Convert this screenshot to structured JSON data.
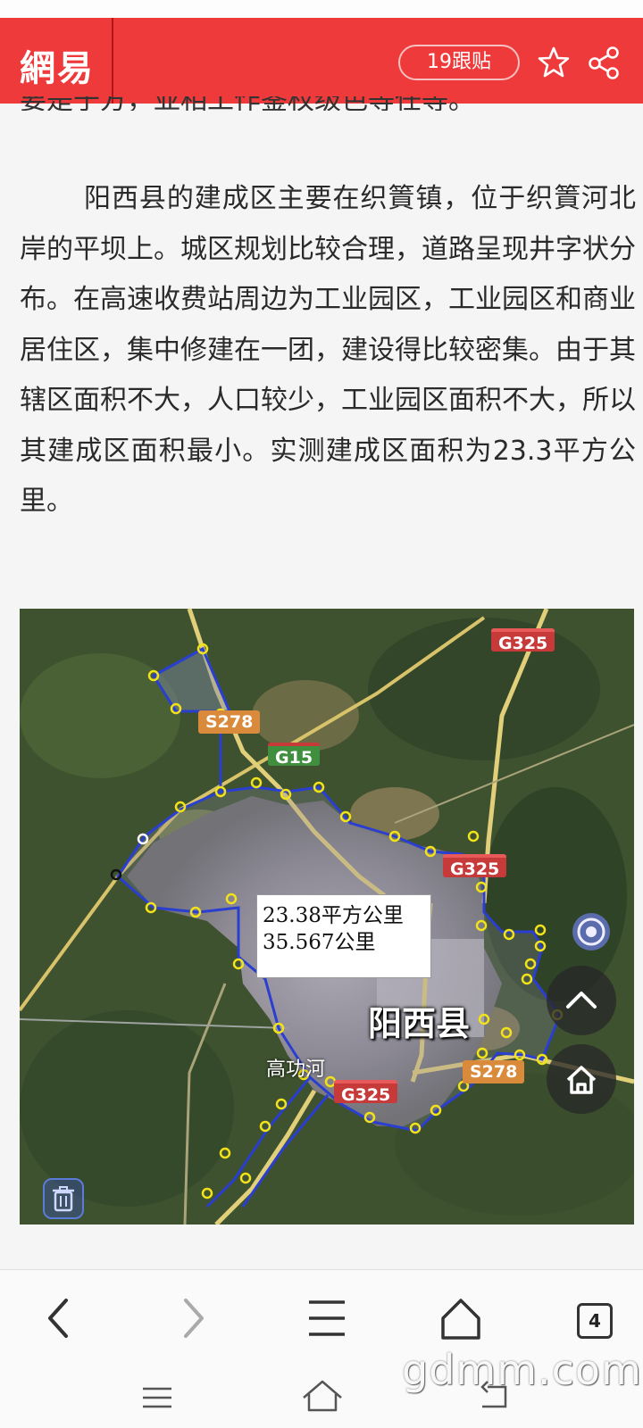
{
  "header": {
    "logo": "網易",
    "comments_label": "19跟贴",
    "accent_color": "#ee3a3a"
  },
  "article": {
    "clipped_line": "要是于方，亚相工作鉴权级色等任等。",
    "paragraph": "阳西县的建成区主要在织篢镇，位于织篢河北岸的平坝上。城区规划比较合理，道路呈现井字状分布。在高速收费站周边为工业园区，工业园区和商业居住区，集中修建在一团，建设得比较密集。由于其辖区面积不大，人口较少，工业园区面积不大，所以其建成区面积最小。实测建成区面积为23.3平方公里。"
  },
  "map": {
    "area_line1": "23.38平方公里",
    "area_line2": "35.567公里",
    "city": "阳西县",
    "river": "高功河",
    "badges": {
      "g325_top": "G325",
      "s278_left": "S278",
      "g15": "G15",
      "g325_mid": "G325",
      "s278_right": "S278",
      "g325_bottom": "G325"
    }
  },
  "toolbar": {
    "tab_count": "4"
  },
  "watermark": "gdmm.com"
}
